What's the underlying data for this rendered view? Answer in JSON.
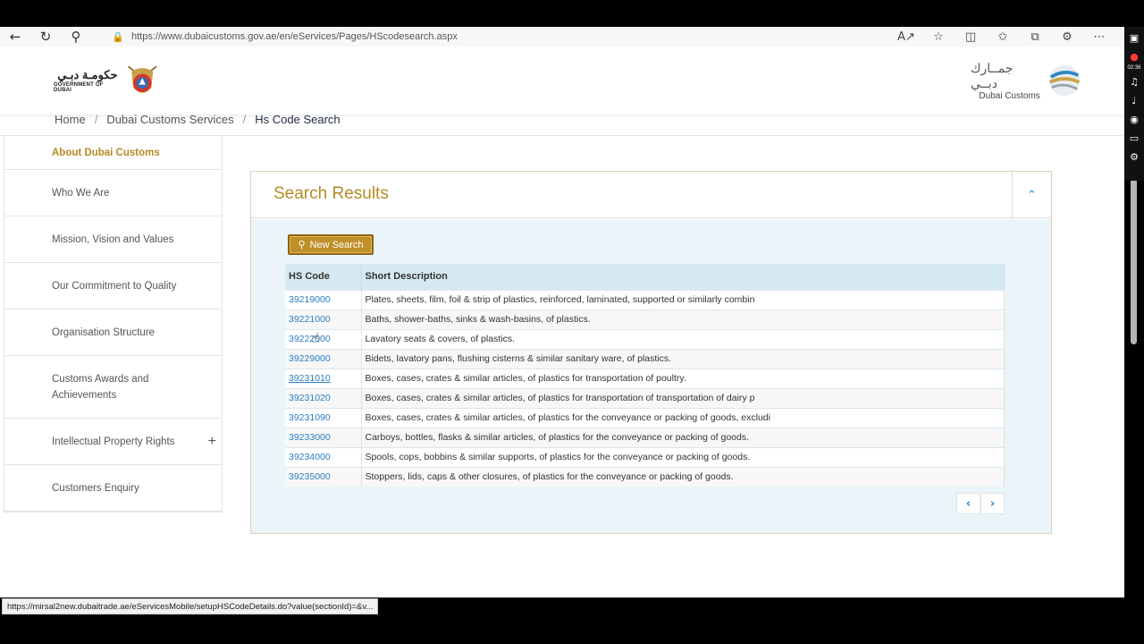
{
  "browser": {
    "url": "https://www.dubaicustoms.gov.ae/en/eServices/Pages/HScodesearch.aspx",
    "status_url": "https://mirsal2new.dubaitrade.ae/eServicesMobile/setupHSCodeDetails.do?value(sectionId)=&v...",
    "nav_icons": [
      "back-icon",
      "refresh-icon",
      "search-icon"
    ],
    "toolbar_icons": [
      "read-aloud-icon",
      "favorite-star-icon",
      "split-screen-icon",
      "favorites-icon",
      "collections-icon",
      "extensions-icon",
      "more-icon"
    ]
  },
  "header": {
    "gov_logo_arabic": "حكومـة دبـي",
    "gov_logo_english": "GOVERNMENT OF DUBAI",
    "dc_logo_arabic": "جمــارك دبــي",
    "dc_logo_english": "Dubai Customs"
  },
  "breadcrumb": {
    "items": [
      "Home",
      "Dubai Customs Services",
      "Hs Code Search"
    ],
    "separator": "/"
  },
  "sidebar": {
    "heading": "About Dubai Customs",
    "items": [
      {
        "label": "Who We Are"
      },
      {
        "label": "Mission, Vision and Values"
      },
      {
        "label": "Our Commitment to Quality"
      },
      {
        "label": "Organisation Structure"
      },
      {
        "label": "Customs Awards and Achievements"
      },
      {
        "label": "Intellectual Property Rights",
        "expand": "+"
      },
      {
        "label": "Customers Enquiry"
      }
    ]
  },
  "results": {
    "title": "Search Results",
    "new_search_label": "New Search",
    "columns": [
      "HS Code",
      "Short Description"
    ],
    "rows": [
      {
        "code": "39219000",
        "desc": "Plates, sheets, film, foil & strip of plastics, reinforced, laminated, supported or similarly combin"
      },
      {
        "code": "39221000",
        "desc": "Baths, shower-baths, sinks & wash-basins, of plastics."
      },
      {
        "code": "39222000",
        "desc": "Lavatory seats & covers, of plastics."
      },
      {
        "code": "39229000",
        "desc": "Bidets, lavatory pans, flushing cisterns & similar sanitary ware, of plastics."
      },
      {
        "code": "39231010",
        "desc": "Boxes, cases, crates & similar articles, of plastics for transportation of poultry."
      },
      {
        "code": "39231020",
        "desc": "Boxes, cases, crates & similar articles, of plastics for transportation of transportation of dairy p"
      },
      {
        "code": "39231090",
        "desc": "Boxes, cases, crates & similar articles, of plastics for the conveyance or packing of goods, excludi"
      },
      {
        "code": "39233000",
        "desc": "Carboys, bottles, flasks & similar articles, of plastics for the conveyance or packing of goods."
      },
      {
        "code": "39234000",
        "desc": "Spools, cops, bobbins & similar supports, of plastics for the conveyance or packing of goods."
      },
      {
        "code": "39235000",
        "desc": "Stoppers, lids, caps & other closures, of plastics for the conveyance or packing of goods."
      }
    ],
    "pager": {
      "prev": "‹",
      "next": "›"
    }
  },
  "recorder": {
    "time": "02:36"
  },
  "colors": {
    "accent_gold": "#b58a24",
    "link_blue": "#2a7dc1",
    "panel_bg": "#eaf4f9"
  }
}
